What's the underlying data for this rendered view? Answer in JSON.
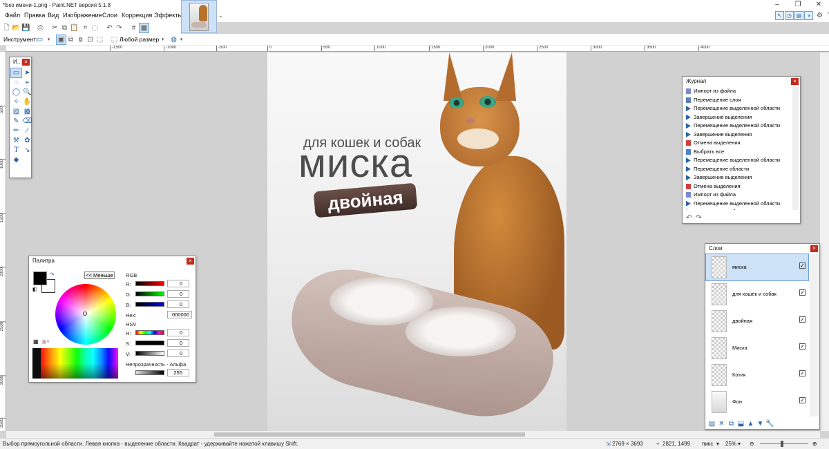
{
  "window": {
    "title": "*Без имени-1.png - Paint.NET версия 5.1.8"
  },
  "menu": [
    "Файл",
    "Правка",
    "Вид",
    "Изображение",
    "Слои",
    "Коррекция",
    "Эффекты"
  ],
  "toolbar": {
    "tool_label": "Инструмент:",
    "size_mode": "Любой размер"
  },
  "rulers": {
    "h": [
      "-1500",
      "-1000",
      "-500",
      "0",
      "500",
      "1000",
      "1500",
      "2000",
      "2500",
      "3000",
      "3500",
      "4000"
    ],
    "v": [
      "500",
      "1000",
      "1500",
      "2000",
      "2500",
      "3000",
      "3500"
    ]
  },
  "tools_panel": {
    "title": "И..."
  },
  "canvas": {
    "line1": "для кошек и собак",
    "line2": "миска",
    "badge": "двойная"
  },
  "history": {
    "title": "Журнал",
    "items": [
      "Импорт из файла",
      "Перемещение слоя",
      "Перемещение выделенной области",
      "Завершение выделения",
      "Перемещение выделенной области",
      "Завершение выделения",
      "Отмена выделения",
      "Выбрать все",
      "Перемещение выделенной области",
      "Перемещение области",
      "Завершение выделения",
      "Отмена выделения",
      "Импорт из файла",
      "Перемещение выделенной области",
      "Перемещение области"
    ]
  },
  "layers": {
    "title": "Слои",
    "items": [
      {
        "name": "миска",
        "selected": true
      },
      {
        "name": "для кошек и собак"
      },
      {
        "name": "двойная"
      },
      {
        "name": "Миска"
      },
      {
        "name": "Котик"
      },
      {
        "name": "Фон"
      }
    ]
  },
  "palette": {
    "title": "Палитра",
    "less_button": "<< Меньше",
    "rgb_label": "RGB",
    "r": "R:",
    "g": "G:",
    "b": "B:",
    "r_val": "0",
    "g_val": "0",
    "b_val": "0",
    "hex_label": "Hex:",
    "hex_val": "000000",
    "hsv_label": "HSV",
    "h": "H:",
    "s": "S:",
    "v": "V:",
    "h_val": "0",
    "s_val": "0",
    "v_val": "0",
    "alpha_label": "Непрозрачность - Альфа",
    "alpha_val": "255",
    "primary_color": "#000000",
    "secondary_color": "#ffffff"
  },
  "status": {
    "hint": "Выбор прямоугольной области. Левая кнопка - выделение области. Квадрат - удерживайте нажатой клавишу Shift.",
    "image_size": "2769 × 3693",
    "cursor": "2821, 1499",
    "units": "пикс",
    "zoom": "25%"
  },
  "colors": {
    "accent": "#2b63a8",
    "close": "#c42b1c"
  }
}
